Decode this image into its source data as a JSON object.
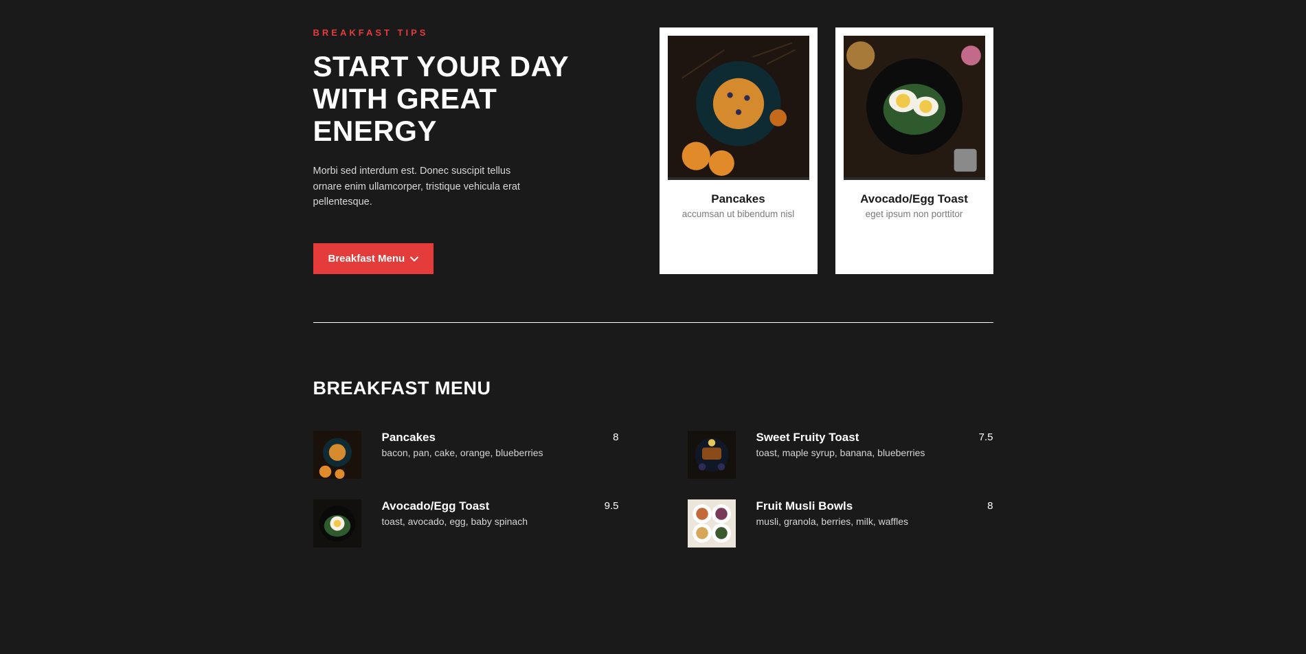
{
  "hero": {
    "overline": "BREAKFAST TIPS",
    "heading": "START YOUR DAY WITH GREAT ENERGY",
    "paragraph": "Morbi sed interdum est. Donec suscipit tellus ornare enim ullamcorper, tristique vehicula erat pellentesque.",
    "cta_label": "Breakfast Menu"
  },
  "cards": [
    {
      "title": "Pancakes",
      "desc": "accumsan ut bibendum nisl"
    },
    {
      "title": "Avocado/Egg Toast",
      "desc": "eget ipsum non porttitor"
    }
  ],
  "menu": {
    "heading": "BREAKFAST MENU",
    "items": [
      {
        "name": "Pancakes",
        "ingredients": "bacon, pan, cake, orange, blueberries",
        "price": "8"
      },
      {
        "name": "Sweet Fruity Toast",
        "ingredients": "toast, maple syrup, banana, blueberries",
        "price": "7.5"
      },
      {
        "name": "Avocado/Egg Toast",
        "ingredients": "toast, avocado, egg, baby spinach",
        "price": "9.5"
      },
      {
        "name": "Fruit Musli Bowls",
        "ingredients": "musli, granola, berries, milk, waffles",
        "price": "8"
      }
    ]
  }
}
